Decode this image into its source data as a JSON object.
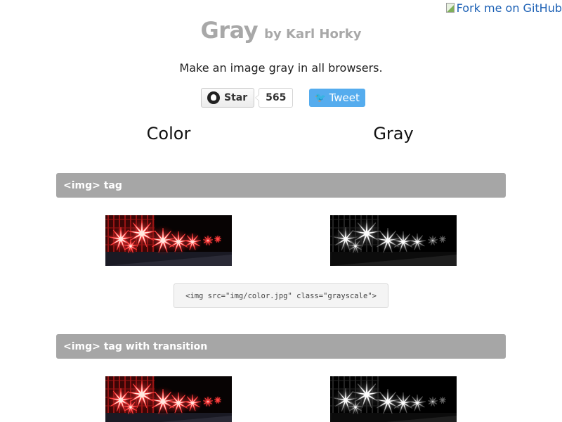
{
  "header": {
    "title": "Gray",
    "byline": "by Karl Horky",
    "tagline": "Make an image gray in all browsers."
  },
  "fork_ribbon": {
    "label": "Fork me on GitHub"
  },
  "social": {
    "star_label": "Star",
    "star_count": "565",
    "tweet_label": "Tweet",
    "github_icon": "github-icon",
    "twitter_icon": "twitter-bird-icon"
  },
  "columns": {
    "color": "Color",
    "gray": "Gray"
  },
  "sections": [
    {
      "title": "<img> tag",
      "code": "<img src=\"img/color.jpg\" class=\"grayscale\">"
    },
    {
      "title": "<img> tag with transition"
    }
  ],
  "colors": {
    "title_gray": "#a8a8a8",
    "section_bar": "#a6a6a6",
    "tweet_blue": "#55acee",
    "link_blue": "#1a5fb4"
  }
}
